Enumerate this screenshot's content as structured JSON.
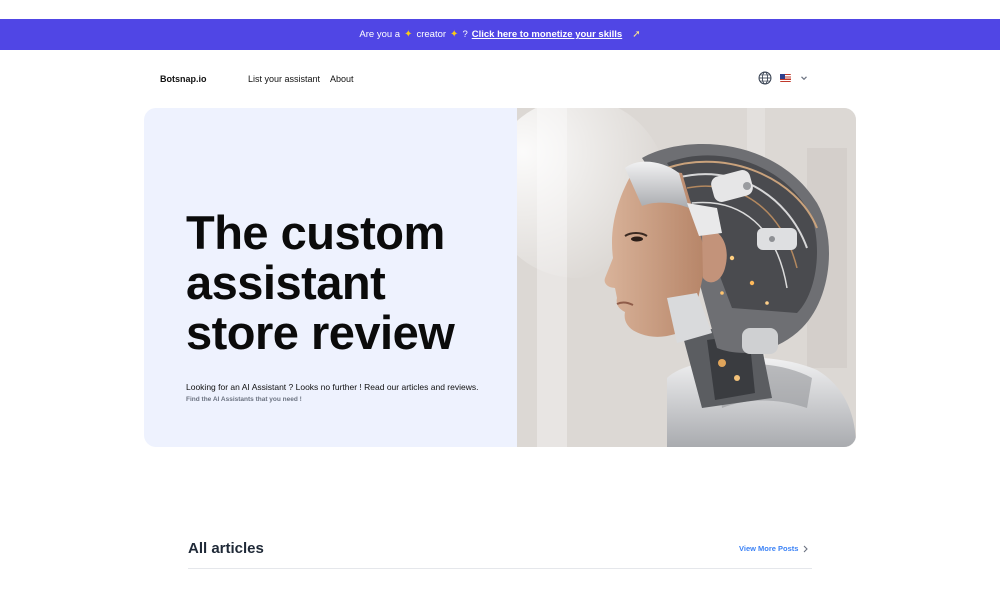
{
  "banner": {
    "prefix": "Are you a",
    "middle": "creator",
    "question": "?",
    "link": "Click here to monetize your skills",
    "sparkle_icon": "sparkles-icon",
    "rocket_icon": "rocket-icon",
    "background_color": "#5046e5"
  },
  "nav": {
    "brand": "Botsnap.io",
    "links": [
      "List your assistant",
      "About"
    ],
    "globe_icon": "globe-icon",
    "flag_icon": "us-flag-icon",
    "chevron_icon": "chevron-down-icon"
  },
  "hero": {
    "title": "The custom assistant store review",
    "description": "Looking for an AI Assistant ? Looks no further ! Read our articles and reviews.",
    "subtitle": "Find the AI Assistants that you need !",
    "background_color": "#eef2fe"
  },
  "articles": {
    "title": "All articles",
    "view_more": "View More Posts",
    "view_more_icon": "chevron-right-icon"
  }
}
